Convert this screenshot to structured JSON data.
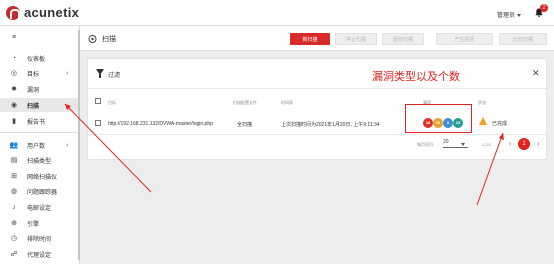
{
  "app": {
    "brand": "acunetix",
    "user": "管理员",
    "notification_count": "2"
  },
  "sidebar": {
    "items": [
      {
        "label": "仪表板",
        "icon": "dashboard-icon",
        "chevron": false
      },
      {
        "label": "目标",
        "icon": "target-icon",
        "chevron": true
      },
      {
        "label": "漏洞",
        "icon": "bug-icon",
        "chevron": false
      },
      {
        "label": "扫描",
        "icon": "scan-icon",
        "chevron": false,
        "active": true
      },
      {
        "label": "报告书",
        "icon": "report-icon",
        "chevron": false
      },
      {
        "label": "用户数",
        "icon": "users-icon",
        "chevron": true
      },
      {
        "label": "扫描类型",
        "icon": "scan-type-icon",
        "chevron": false
      },
      {
        "label": "网络扫描仪",
        "icon": "network-scanner-icon",
        "chevron": false
      },
      {
        "label": "问题跟踪器",
        "icon": "issue-tracker-icon",
        "chevron": false
      },
      {
        "label": "电邮设定",
        "icon": "email-icon",
        "chevron": false
      },
      {
        "label": "引擎",
        "icon": "engine-icon",
        "chevron": false
      },
      {
        "label": "排除时间",
        "icon": "clock-icon",
        "chevron": false
      },
      {
        "label": "代理设定",
        "icon": "proxy-icon",
        "chevron": false
      }
    ]
  },
  "header": {
    "title": "扫描",
    "buttons": [
      {
        "label": "新扫描",
        "enabled": true
      },
      {
        "label": "停止扫描",
        "enabled": false
      },
      {
        "label": "删除扫描",
        "enabled": false
      },
      {
        "label": "产生报告",
        "enabled": false
      },
      {
        "label": "比较扫描",
        "enabled": false
      }
    ]
  },
  "filter": {
    "label": "过滤"
  },
  "annotation": "漏洞类型以及个数",
  "table": {
    "columns": [
      "目标",
      "扫描配置文件",
      "时间表",
      "漏洞",
      "状态"
    ],
    "rows": [
      {
        "target": "http://192.168.231.132/DVWA-master/login.php",
        "profile": "全扫描",
        "schedule": "上次扫描时间为2021年1月20日, 上午9:11:34",
        "vulns": [
          {
            "count": "18",
            "color": "#d9342b"
          },
          {
            "count": "30",
            "color": "#f0a030"
          },
          {
            "count": "8",
            "color": "#3a8fd8"
          },
          {
            "count": "15",
            "color": "#2a9d8f"
          }
        ],
        "status": "已完成"
      }
    ]
  },
  "pagination": {
    "per_page_label": "每页项目:",
    "per_page": "20",
    "range": "1-2/1",
    "page": "1"
  }
}
